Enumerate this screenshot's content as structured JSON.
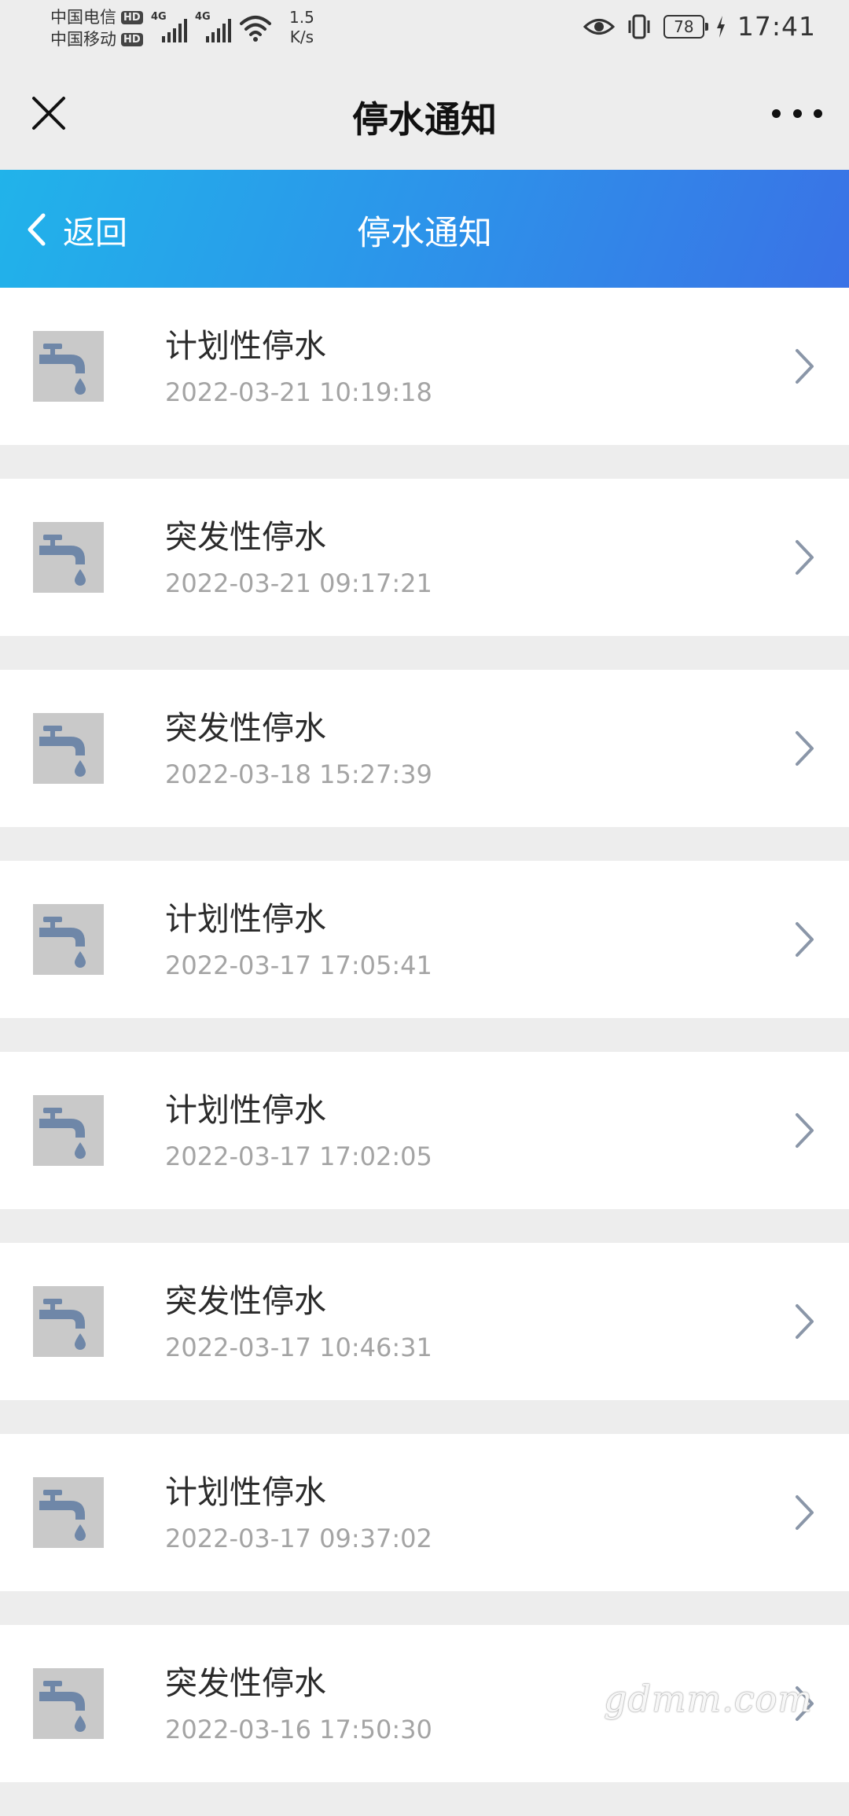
{
  "status_bar": {
    "carrier1": "中国电信",
    "carrier2": "中国移动",
    "hd_label": "HD",
    "network1": "4G",
    "network2": "4G",
    "speed_value": "1.5",
    "speed_unit": "K/s",
    "battery": "78",
    "time": "17:41"
  },
  "titlebar": {
    "title": "停水通知",
    "close_icon": "close-icon",
    "more_icon": "more-icon"
  },
  "header": {
    "back_label": "返回",
    "title": "停水通知"
  },
  "notices": [
    {
      "type": "计划性停水",
      "datetime": "2022-03-21 10:19:18"
    },
    {
      "type": "突发性停水",
      "datetime": "2022-03-21 09:17:21"
    },
    {
      "type": "突发性停水",
      "datetime": "2022-03-18 15:27:39"
    },
    {
      "type": "计划性停水",
      "datetime": "2022-03-17 17:05:41"
    },
    {
      "type": "计划性停水",
      "datetime": "2022-03-17 17:02:05"
    },
    {
      "type": "突发性停水",
      "datetime": "2022-03-17 10:46:31"
    },
    {
      "type": "计划性停水",
      "datetime": "2022-03-17 09:37:02"
    },
    {
      "type": "突发性停水",
      "datetime": "2022-03-16 17:50:30"
    }
  ],
  "watermark": "gdmm.com",
  "colors": {
    "header_start": "#21b3ea",
    "header_end": "#3a72e6",
    "icon_fg": "#6f87a8",
    "icon_bg": "#c9c9c9"
  }
}
